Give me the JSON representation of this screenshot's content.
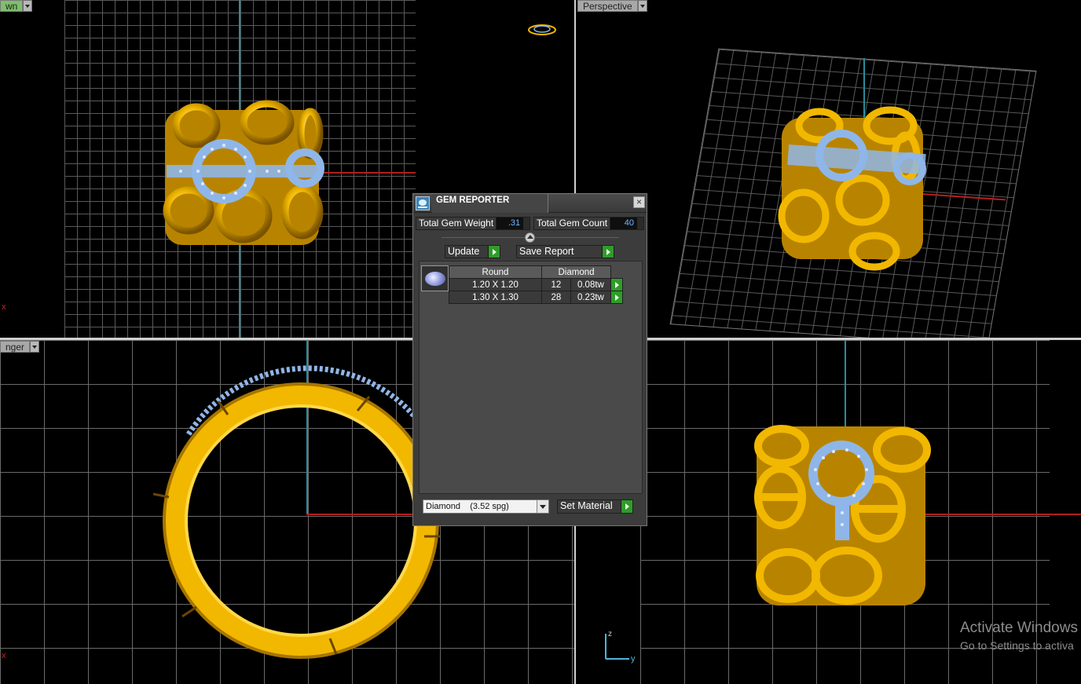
{
  "viewports": {
    "top_left": {
      "label": "wn"
    },
    "top_right": {
      "label": "Perspective"
    },
    "bottom_left": {
      "label": "nger"
    },
    "bottom_right": {
      "label": ""
    }
  },
  "axis_marks": {
    "x": "x",
    "z": "z",
    "y": "y"
  },
  "gem_reporter": {
    "title": "GEM REPORTER",
    "close": "×",
    "total_weight_label": "Total Gem Weight",
    "total_weight_value": ".31",
    "total_count_label": "Total Gem Count",
    "total_count_value": "40",
    "update_label": "Update",
    "save_report_label": "Save Report",
    "table": {
      "headers": [
        "Round",
        "Diamond"
      ],
      "rows": [
        {
          "size": "1.20 X 1.20",
          "count": "12",
          "weight": "0.08tw"
        },
        {
          "size": "1.30 X 1.30",
          "count": "28",
          "weight": "0.23tw"
        }
      ]
    },
    "material_value": "Diamond    (3.52 spg)",
    "set_material_label": "Set Material"
  },
  "watermark": {
    "title": "Activate Windows",
    "subtitle": "Go to Settings to activa"
  },
  "colors": {
    "gold": "#f2b800",
    "gem_blue": "#8fb6e8",
    "axis_red": "#b41e1e",
    "axis_cyan": "#2a8c9a",
    "go_green": "#2f9c2a"
  }
}
